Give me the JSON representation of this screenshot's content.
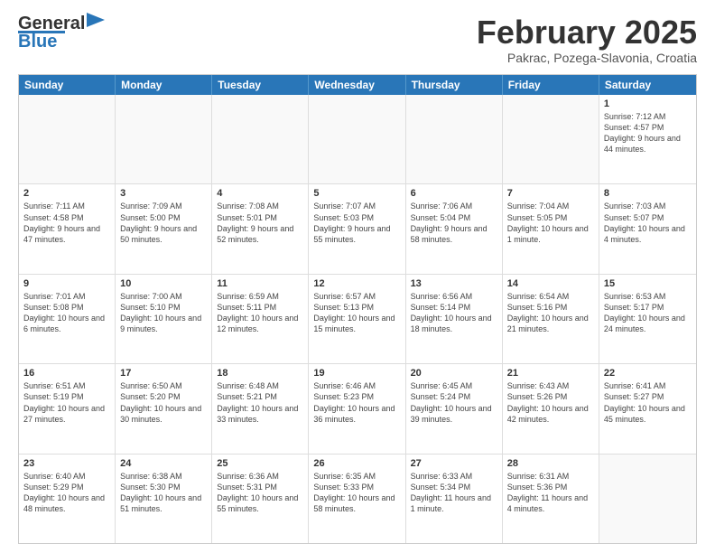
{
  "header": {
    "logo_line1": "General",
    "logo_line2": "Blue",
    "title": "February 2025",
    "subtitle": "Pakrac, Pozega-Slavonia, Croatia"
  },
  "days_of_week": [
    "Sunday",
    "Monday",
    "Tuesday",
    "Wednesday",
    "Thursday",
    "Friday",
    "Saturday"
  ],
  "weeks": [
    [
      {
        "day": "",
        "info": ""
      },
      {
        "day": "",
        "info": ""
      },
      {
        "day": "",
        "info": ""
      },
      {
        "day": "",
        "info": ""
      },
      {
        "day": "",
        "info": ""
      },
      {
        "day": "",
        "info": ""
      },
      {
        "day": "1",
        "info": "Sunrise: 7:12 AM\nSunset: 4:57 PM\nDaylight: 9 hours and 44 minutes."
      }
    ],
    [
      {
        "day": "2",
        "info": "Sunrise: 7:11 AM\nSunset: 4:58 PM\nDaylight: 9 hours and 47 minutes."
      },
      {
        "day": "3",
        "info": "Sunrise: 7:09 AM\nSunset: 5:00 PM\nDaylight: 9 hours and 50 minutes."
      },
      {
        "day": "4",
        "info": "Sunrise: 7:08 AM\nSunset: 5:01 PM\nDaylight: 9 hours and 52 minutes."
      },
      {
        "day": "5",
        "info": "Sunrise: 7:07 AM\nSunset: 5:03 PM\nDaylight: 9 hours and 55 minutes."
      },
      {
        "day": "6",
        "info": "Sunrise: 7:06 AM\nSunset: 5:04 PM\nDaylight: 9 hours and 58 minutes."
      },
      {
        "day": "7",
        "info": "Sunrise: 7:04 AM\nSunset: 5:05 PM\nDaylight: 10 hours and 1 minute."
      },
      {
        "day": "8",
        "info": "Sunrise: 7:03 AM\nSunset: 5:07 PM\nDaylight: 10 hours and 4 minutes."
      }
    ],
    [
      {
        "day": "9",
        "info": "Sunrise: 7:01 AM\nSunset: 5:08 PM\nDaylight: 10 hours and 6 minutes."
      },
      {
        "day": "10",
        "info": "Sunrise: 7:00 AM\nSunset: 5:10 PM\nDaylight: 10 hours and 9 minutes."
      },
      {
        "day": "11",
        "info": "Sunrise: 6:59 AM\nSunset: 5:11 PM\nDaylight: 10 hours and 12 minutes."
      },
      {
        "day": "12",
        "info": "Sunrise: 6:57 AM\nSunset: 5:13 PM\nDaylight: 10 hours and 15 minutes."
      },
      {
        "day": "13",
        "info": "Sunrise: 6:56 AM\nSunset: 5:14 PM\nDaylight: 10 hours and 18 minutes."
      },
      {
        "day": "14",
        "info": "Sunrise: 6:54 AM\nSunset: 5:16 PM\nDaylight: 10 hours and 21 minutes."
      },
      {
        "day": "15",
        "info": "Sunrise: 6:53 AM\nSunset: 5:17 PM\nDaylight: 10 hours and 24 minutes."
      }
    ],
    [
      {
        "day": "16",
        "info": "Sunrise: 6:51 AM\nSunset: 5:19 PM\nDaylight: 10 hours and 27 minutes."
      },
      {
        "day": "17",
        "info": "Sunrise: 6:50 AM\nSunset: 5:20 PM\nDaylight: 10 hours and 30 minutes."
      },
      {
        "day": "18",
        "info": "Sunrise: 6:48 AM\nSunset: 5:21 PM\nDaylight: 10 hours and 33 minutes."
      },
      {
        "day": "19",
        "info": "Sunrise: 6:46 AM\nSunset: 5:23 PM\nDaylight: 10 hours and 36 minutes."
      },
      {
        "day": "20",
        "info": "Sunrise: 6:45 AM\nSunset: 5:24 PM\nDaylight: 10 hours and 39 minutes."
      },
      {
        "day": "21",
        "info": "Sunrise: 6:43 AM\nSunset: 5:26 PM\nDaylight: 10 hours and 42 minutes."
      },
      {
        "day": "22",
        "info": "Sunrise: 6:41 AM\nSunset: 5:27 PM\nDaylight: 10 hours and 45 minutes."
      }
    ],
    [
      {
        "day": "23",
        "info": "Sunrise: 6:40 AM\nSunset: 5:29 PM\nDaylight: 10 hours and 48 minutes."
      },
      {
        "day": "24",
        "info": "Sunrise: 6:38 AM\nSunset: 5:30 PM\nDaylight: 10 hours and 51 minutes."
      },
      {
        "day": "25",
        "info": "Sunrise: 6:36 AM\nSunset: 5:31 PM\nDaylight: 10 hours and 55 minutes."
      },
      {
        "day": "26",
        "info": "Sunrise: 6:35 AM\nSunset: 5:33 PM\nDaylight: 10 hours and 58 minutes."
      },
      {
        "day": "27",
        "info": "Sunrise: 6:33 AM\nSunset: 5:34 PM\nDaylight: 11 hours and 1 minute."
      },
      {
        "day": "28",
        "info": "Sunrise: 6:31 AM\nSunset: 5:36 PM\nDaylight: 11 hours and 4 minutes."
      },
      {
        "day": "",
        "info": ""
      }
    ]
  ]
}
